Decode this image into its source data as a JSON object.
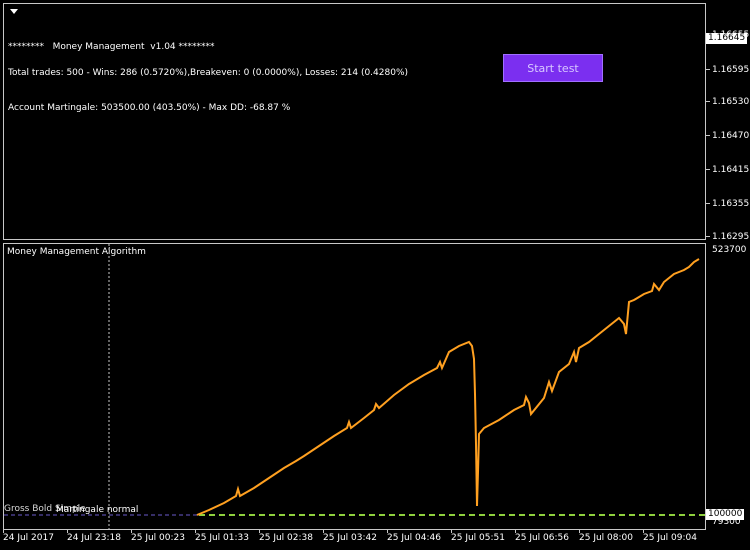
{
  "main_pane": {
    "header_line": "********   Money Management  v1.04 ********",
    "trades_line": "Total trades: 500 - Wins: 286 (0.5720%),Breakeven: 0 (0.0000%), Losses: 214 (0.4280%)",
    "account_line": "Account Martingale: 503500.00 (403.50%) - Max DD: -68.87 %",
    "start_button": "Start test",
    "price_scale": [
      "1.16655",
      "1.16595",
      "1.16530",
      "1.16470",
      "1.16415",
      "1.16355",
      "1.16295"
    ],
    "current_price": "1.16645"
  },
  "sub_pane": {
    "indicator_title": "Money Management Algorithm",
    "legend_label": "Martingale normal",
    "legend_overlap_text": "Gross Bold Simple",
    "scale": [
      "523700"
    ],
    "current_value": "100000",
    "min_value": "79300"
  },
  "time_axis": [
    "24 Jul 2017",
    "24 Jul 23:18",
    "25 Jul 00:23",
    "25 Jul 01:33",
    "25 Jul 02:38",
    "25 Jul 03:42",
    "25 Jul 04:46",
    "25 Jul 05:51",
    "25 Jul 06:56",
    "25 Jul 08:00",
    "25 Jul 09:04"
  ],
  "colors": {
    "equity_line": "#ffa020",
    "baseline": "#8fd13f",
    "baseline_alt": "#6a5acd",
    "button": "#7b2ff0"
  }
}
